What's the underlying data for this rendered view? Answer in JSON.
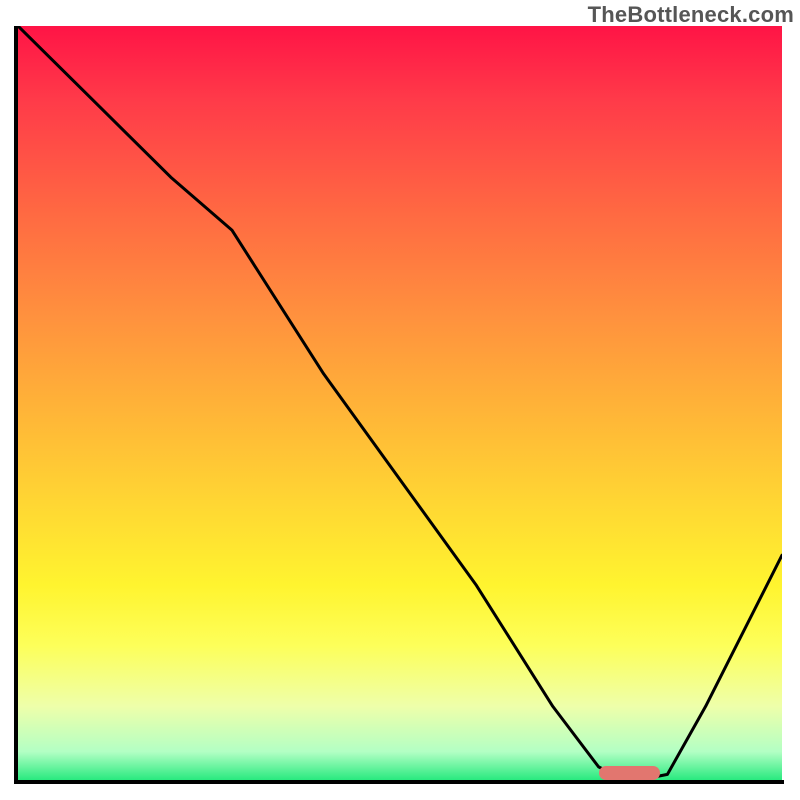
{
  "watermark": "TheBottleneck.com",
  "colors": {
    "top": "#ff1446",
    "bottom": "#1fe87a",
    "curve": "#000000",
    "optimal_marker": "#e2766f",
    "axis": "#000000"
  },
  "chart_data": {
    "type": "line",
    "title": "",
    "xlabel": "",
    "ylabel": "",
    "xlim": [
      0,
      100
    ],
    "ylim": [
      0,
      100
    ],
    "x": [
      0,
      10,
      20,
      28,
      40,
      50,
      60,
      70,
      76,
      80,
      85,
      90,
      95,
      100
    ],
    "values": [
      100,
      90,
      80,
      73,
      54,
      40,
      26,
      10,
      2,
      0,
      1,
      10,
      20,
      30
    ],
    "optimal_range_x": [
      76,
      84
    ],
    "gradient_stops": [
      {
        "pos": 0.0,
        "color": "#ff1446"
      },
      {
        "pos": 0.5,
        "color": "#ffb238"
      },
      {
        "pos": 0.8,
        "color": "#fdff5a"
      },
      {
        "pos": 1.0,
        "color": "#1fe87a"
      }
    ]
  }
}
